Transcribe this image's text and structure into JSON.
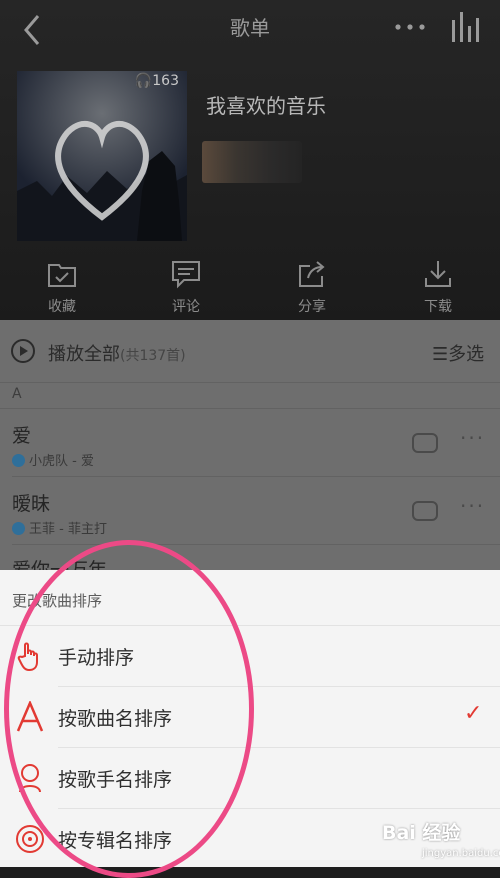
{
  "nav": {
    "title": "歌单"
  },
  "playlist": {
    "name": "我喜欢的音乐",
    "listen_count": "163"
  },
  "actions": [
    {
      "label": "收藏",
      "icon": "collect-icon"
    },
    {
      "label": "评论",
      "icon": "comment-icon"
    },
    {
      "label": "分享",
      "icon": "share-icon"
    },
    {
      "label": "下载",
      "icon": "download-icon"
    }
  ],
  "list": {
    "play_all": "播放全部",
    "count": "(共137首)",
    "multi_select": "多选",
    "section": "A",
    "songs": [
      {
        "title": "爱",
        "subtitle": "小虎队 - 爱"
      },
      {
        "title": "暧昧",
        "subtitle": "王菲 - 菲主打"
      },
      {
        "title": "爱你一万年",
        "subtitle": ""
      }
    ]
  },
  "sort_sheet": {
    "title": "更改歌曲排序",
    "options": [
      {
        "label": "手动排序",
        "icon": "hand-icon",
        "selected": false
      },
      {
        "label": "按歌曲名排序",
        "icon": "letter-a-icon",
        "selected": true
      },
      {
        "label": "按歌手名排序",
        "icon": "singer-icon",
        "selected": false
      },
      {
        "label": "按专辑名排序",
        "icon": "album-icon",
        "selected": false
      }
    ],
    "check_mark": "✓"
  },
  "watermark": {
    "brand": "Bai 经验",
    "url": "jingyan.baidu.com"
  },
  "colors": {
    "accent": "#e23a33",
    "annotation": "#ec4a86"
  }
}
